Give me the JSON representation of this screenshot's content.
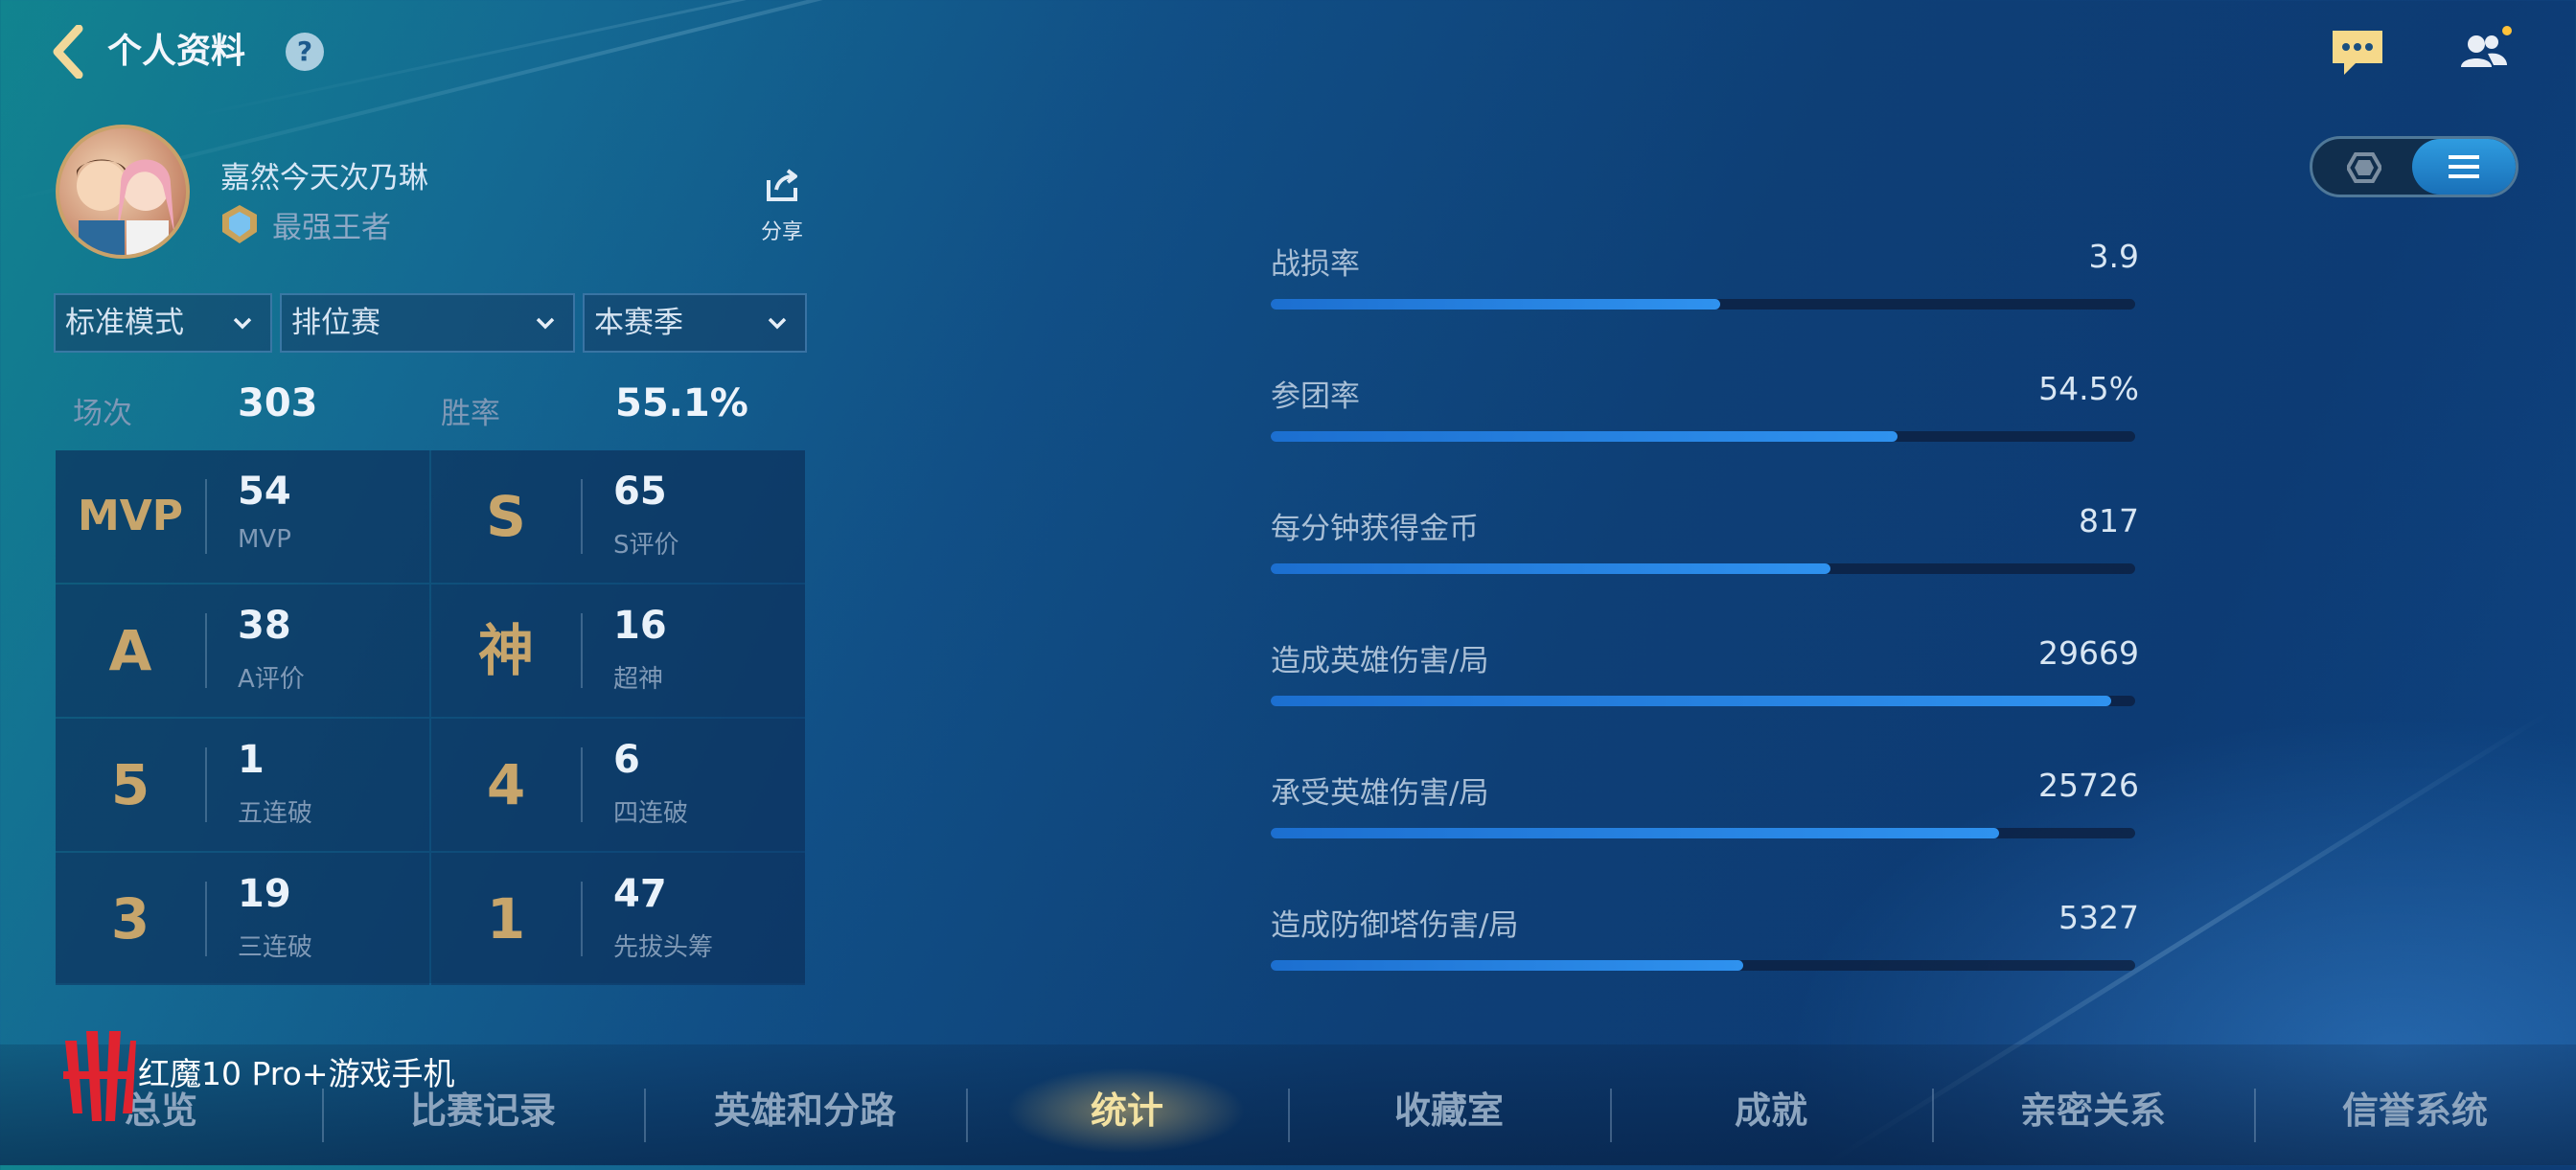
{
  "header": {
    "title": "个人资料",
    "help_icon": "?"
  },
  "profile": {
    "username": "嘉然今天次乃琳",
    "rank": "最强王者",
    "share_label": "分享"
  },
  "filters": {
    "mode": "标准模式",
    "match_type": "排位赛",
    "season": "本赛季"
  },
  "summary": {
    "games_label": "场次",
    "games_value": "303",
    "winrate_label": "胜率",
    "winrate_value": "55.1%"
  },
  "achievements": [
    {
      "badge": "MVP",
      "value": "54",
      "label": "MVP"
    },
    {
      "badge": "S",
      "value": "65",
      "label": "S评价"
    },
    {
      "badge": "A",
      "value": "38",
      "label": "A评价"
    },
    {
      "badge": "神",
      "value": "16",
      "label": "超神"
    },
    {
      "badge": "5",
      "value": "1",
      "label": "五连破"
    },
    {
      "badge": "4",
      "value": "6",
      "label": "四连破"
    },
    {
      "badge": "3",
      "value": "19",
      "label": "三连破"
    },
    {
      "badge": "1",
      "value": "47",
      "label": "先拔头筹"
    }
  ],
  "stats": [
    {
      "label": "战损率",
      "value": "3.9",
      "fill": 0.52
    },
    {
      "label": "参团率",
      "value": "54.5%",
      "fill": 0.725
    },
    {
      "label": "每分钟获得金币",
      "value": "817",
      "fill": 0.647
    },
    {
      "label": "造成英雄伤害/局",
      "value": "29669",
      "fill": 0.972
    },
    {
      "label": "承受英雄伤害/局",
      "value": "25726",
      "fill": 0.843
    },
    {
      "label": "造成防御塔伤害/局",
      "value": "5327",
      "fill": 0.547
    }
  ],
  "nav_tabs": [
    {
      "label": "总览"
    },
    {
      "label": "比赛记录"
    },
    {
      "label": "英雄和分路"
    },
    {
      "label": "统计",
      "active": true
    },
    {
      "label": "收藏室"
    },
    {
      "label": "成就"
    },
    {
      "label": "亲密关系"
    },
    {
      "label": "信誉系统"
    }
  ],
  "watermark": "红魔10 Pro+游戏手机",
  "icons": {
    "back": "chevron-left-icon",
    "chat": "chat-bubble-icon",
    "friends": "friends-icon",
    "share": "share-icon",
    "view_toggle_left": "hexagon-icon",
    "view_toggle_right": "list-icon"
  },
  "colors": {
    "accent_gold": "#c7a56b",
    "bar_blue": "#2f92ef",
    "active_tab": "#f3e2a2"
  }
}
